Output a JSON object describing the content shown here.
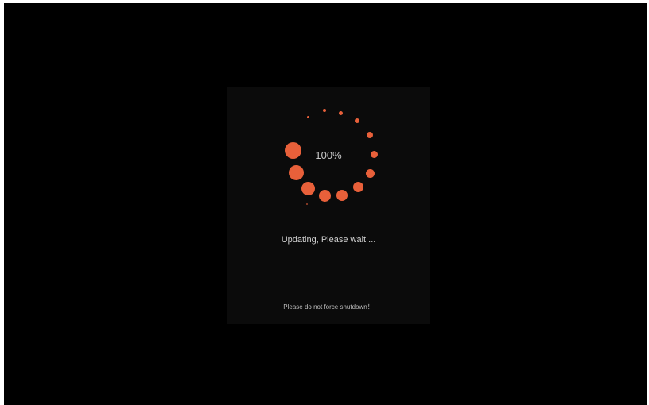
{
  "progress": {
    "percent_text": "100%",
    "value": 100
  },
  "status_text": "Updating, Please wait ...",
  "warning_text": "Please do not force shutdown！",
  "spinner": {
    "icon": "loading-spinner-icon",
    "dot_color": "#e8603a"
  },
  "colors": {
    "screen_background": "#000000",
    "dialog_background": "#0b0b0b",
    "accent": "#e8603a"
  }
}
